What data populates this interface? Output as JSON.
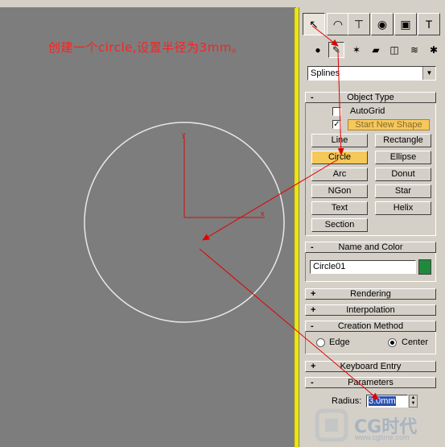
{
  "annotation": "创建一个circle,设置半径为3mm。",
  "viewport": {
    "axis_x": "x",
    "axis_y": "y"
  },
  "command_panel": {
    "tabs": [
      {
        "icon": "create-icon",
        "glyph": "↖",
        "active": true
      },
      {
        "icon": "modify-icon",
        "glyph": "◠",
        "active": false
      },
      {
        "icon": "hierarchy-icon",
        "glyph": "⊤",
        "active": false
      },
      {
        "icon": "motion-icon",
        "glyph": "◉",
        "active": false
      },
      {
        "icon": "display-icon",
        "glyph": "▣",
        "active": false
      },
      {
        "icon": "utilities-icon",
        "glyph": "T",
        "active": false
      }
    ],
    "categories": [
      {
        "icon": "geometry-icon",
        "glyph": "●",
        "active": false
      },
      {
        "icon": "shapes-icon",
        "glyph": "✎",
        "active": true
      },
      {
        "icon": "lights-icon",
        "glyph": "✶",
        "active": false
      },
      {
        "icon": "cameras-icon",
        "glyph": "▰",
        "active": false
      },
      {
        "icon": "helpers-icon",
        "glyph": "◫",
        "active": false
      },
      {
        "icon": "space-warps-icon",
        "glyph": "≋",
        "active": false
      },
      {
        "icon": "systems-icon",
        "glyph": "✱",
        "active": false
      }
    ],
    "dropdown": "Splines",
    "object_type": {
      "title": "Object Type",
      "autogrid": "AutoGrid",
      "start_new_shape": "Start New Shape",
      "buttons": [
        "Line",
        "Rectangle",
        "Circle",
        "Ellipse",
        "Arc",
        "Donut",
        "NGon",
        "Star",
        "Text",
        "Helix",
        "Section"
      ],
      "active": "Circle"
    },
    "name_and_color": {
      "title": "Name and Color",
      "name": "Circle01",
      "color": "#1f8a3e"
    },
    "rendering": {
      "title": "Rendering"
    },
    "interpolation": {
      "title": "Interpolation"
    },
    "creation_method": {
      "title": "Creation Method",
      "edge": "Edge",
      "center": "Center",
      "selected": "Center"
    },
    "keyboard_entry": {
      "title": "Keyboard Entry"
    },
    "parameters": {
      "title": "Parameters",
      "radius_label": "Radius:",
      "radius_value": "3.0mm"
    }
  },
  "watermark": {
    "text": "CG时代",
    "url": "www.cgtime.com"
  },
  "colors": {
    "annotation": "#ff2020",
    "viewport_border": "#f0e800",
    "active_button": "#f5c85a"
  }
}
